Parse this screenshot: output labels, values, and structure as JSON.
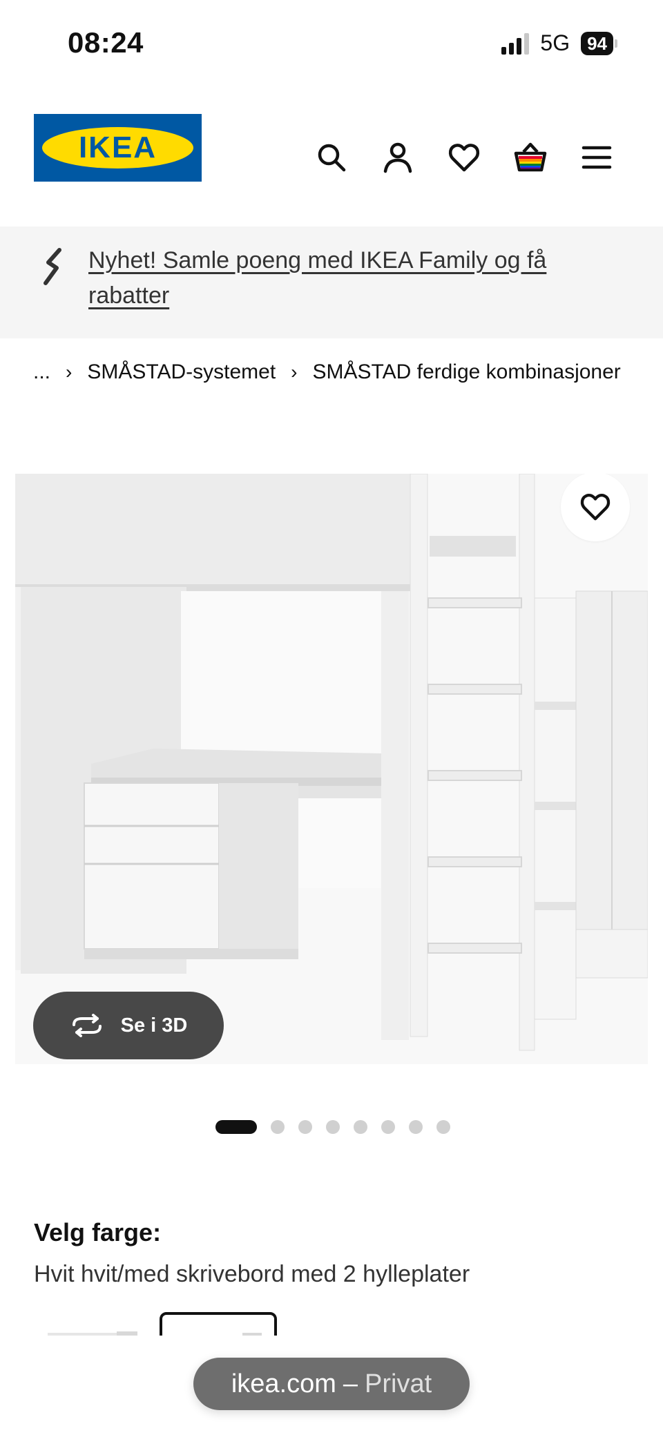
{
  "status_bar": {
    "time": "08:24",
    "network": "5G",
    "battery": "94"
  },
  "header": {
    "logo_text": "IKEA",
    "icons": [
      "search-icon",
      "profile-icon",
      "heart-icon",
      "cart-icon",
      "menu-icon"
    ]
  },
  "banner": {
    "text": "Nyhet! Samle poeng med IKEA Family og få rabatter"
  },
  "breadcrumb": {
    "ellipsis": "...",
    "items": [
      "SMÅSTAD-systemet",
      "SMÅSTAD ferdige kombinasjoner"
    ],
    "separator": "›"
  },
  "product": {
    "view_3d_label": "Se i 3D",
    "carousel": {
      "total": 8,
      "active": 0
    }
  },
  "color": {
    "label": "Velg farge:",
    "value": "Hvit hvit/med skrivebord med 2 hylleplater"
  },
  "browser": {
    "domain": "ikea.com",
    "separator": "–",
    "mode": "Privat"
  },
  "colors": {
    "ikea_blue": "#0058a3",
    "ikea_yellow": "#ffdb00",
    "banner_bg": "#f5f5f5",
    "button_dark": "#484848"
  }
}
